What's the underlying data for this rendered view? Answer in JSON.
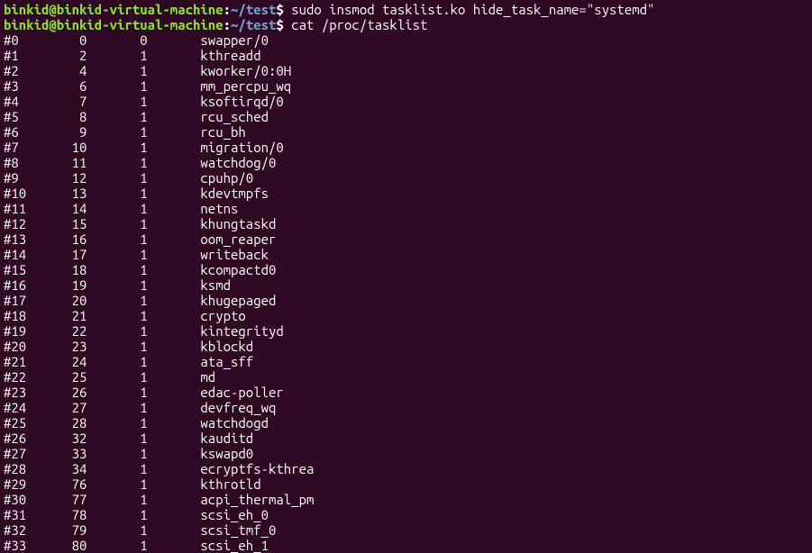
{
  "prompt1": {
    "user_host": "binkid@binkid-virtual-machine",
    "colon": ":",
    "path": "~/test",
    "dollar": "$",
    "command": " sudo insmod tasklist.ko hide_task_name=\"systemd\""
  },
  "prompt2": {
    "user_host": "binkid@binkid-virtual-machine",
    "colon": ":",
    "path": "~/test",
    "dollar": "$",
    "command": " cat /proc/tasklist"
  },
  "rows": [
    {
      "idx": "#0",
      "pid": "0",
      "ppid": "0",
      "name": "swapper/0"
    },
    {
      "idx": "#1",
      "pid": "2",
      "ppid": "1",
      "name": "kthreadd"
    },
    {
      "idx": "#2",
      "pid": "4",
      "ppid": "1",
      "name": "kworker/0:0H"
    },
    {
      "idx": "#3",
      "pid": "6",
      "ppid": "1",
      "name": "mm_percpu_wq"
    },
    {
      "idx": "#4",
      "pid": "7",
      "ppid": "1",
      "name": "ksoftirqd/0"
    },
    {
      "idx": "#5",
      "pid": "8",
      "ppid": "1",
      "name": "rcu_sched"
    },
    {
      "idx": "#6",
      "pid": "9",
      "ppid": "1",
      "name": "rcu_bh"
    },
    {
      "idx": "#7",
      "pid": "10",
      "ppid": "1",
      "name": "migration/0"
    },
    {
      "idx": "#8",
      "pid": "11",
      "ppid": "1",
      "name": "watchdog/0"
    },
    {
      "idx": "#9",
      "pid": "12",
      "ppid": "1",
      "name": "cpuhp/0"
    },
    {
      "idx": "#10",
      "pid": "13",
      "ppid": "1",
      "name": "kdevtmpfs"
    },
    {
      "idx": "#11",
      "pid": "14",
      "ppid": "1",
      "name": "netns"
    },
    {
      "idx": "#12",
      "pid": "15",
      "ppid": "1",
      "name": "khungtaskd"
    },
    {
      "idx": "#13",
      "pid": "16",
      "ppid": "1",
      "name": "oom_reaper"
    },
    {
      "idx": "#14",
      "pid": "17",
      "ppid": "1",
      "name": "writeback"
    },
    {
      "idx": "#15",
      "pid": "18",
      "ppid": "1",
      "name": "kcompactd0"
    },
    {
      "idx": "#16",
      "pid": "19",
      "ppid": "1",
      "name": "ksmd"
    },
    {
      "idx": "#17",
      "pid": "20",
      "ppid": "1",
      "name": "khugepaged"
    },
    {
      "idx": "#18",
      "pid": "21",
      "ppid": "1",
      "name": "crypto"
    },
    {
      "idx": "#19",
      "pid": "22",
      "ppid": "1",
      "name": "kintegrityd"
    },
    {
      "idx": "#20",
      "pid": "23",
      "ppid": "1",
      "name": "kblockd"
    },
    {
      "idx": "#21",
      "pid": "24",
      "ppid": "1",
      "name": "ata_sff"
    },
    {
      "idx": "#22",
      "pid": "25",
      "ppid": "1",
      "name": "md"
    },
    {
      "idx": "#23",
      "pid": "26",
      "ppid": "1",
      "name": "edac-poller"
    },
    {
      "idx": "#24",
      "pid": "27",
      "ppid": "1",
      "name": "devfreq_wq"
    },
    {
      "idx": "#25",
      "pid": "28",
      "ppid": "1",
      "name": "watchdogd"
    },
    {
      "idx": "#26",
      "pid": "32",
      "ppid": "1",
      "name": "kauditd"
    },
    {
      "idx": "#27",
      "pid": "33",
      "ppid": "1",
      "name": "kswapd0"
    },
    {
      "idx": "#28",
      "pid": "34",
      "ppid": "1",
      "name": "ecryptfs-kthrea"
    },
    {
      "idx": "#29",
      "pid": "76",
      "ppid": "1",
      "name": "kthrotld"
    },
    {
      "idx": "#30",
      "pid": "77",
      "ppid": "1",
      "name": "acpi_thermal_pm"
    },
    {
      "idx": "#31",
      "pid": "78",
      "ppid": "1",
      "name": "scsi_eh_0"
    },
    {
      "idx": "#32",
      "pid": "79",
      "ppid": "1",
      "name": "scsi_tmf_0"
    },
    {
      "idx": "#33",
      "pid": "80",
      "ppid": "1",
      "name": "scsi_eh_1"
    }
  ]
}
